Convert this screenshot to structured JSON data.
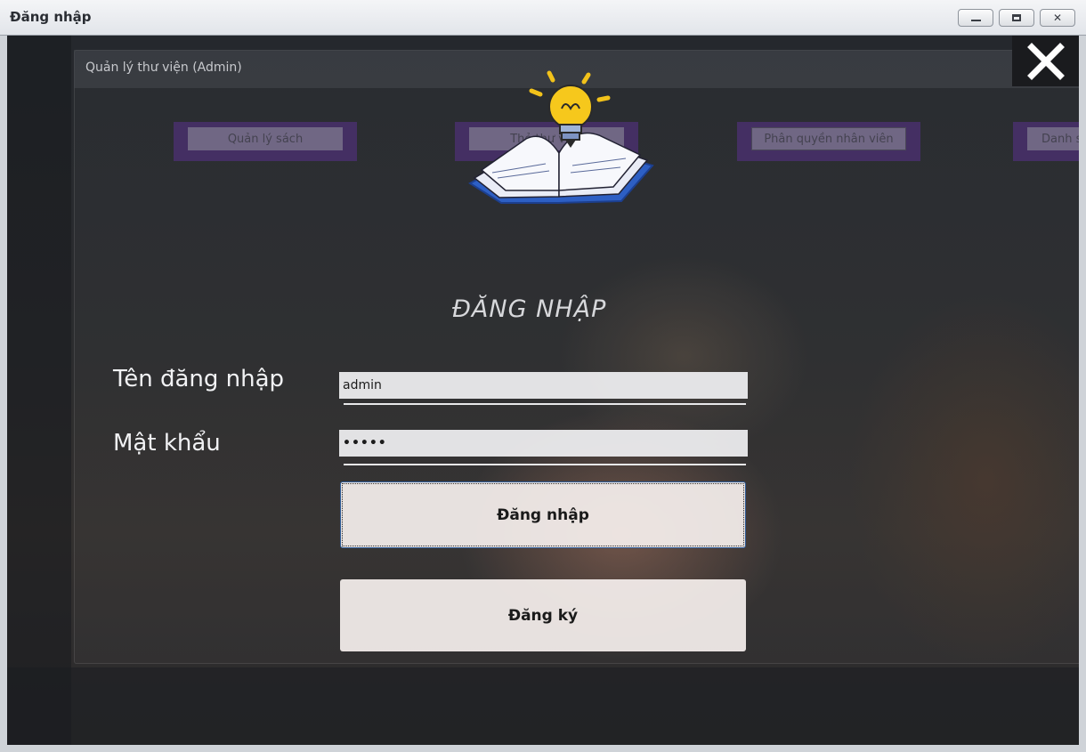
{
  "window": {
    "title": "Đăng nhập"
  },
  "background_app": {
    "title": "Quản lý thư viện (Admin)",
    "menu": [
      "Quản lý sách",
      "Thẻ thư viện",
      "Phân quyền nhân viên",
      "Danh s"
    ]
  },
  "login": {
    "heading": "ĐĂNG NHẬP",
    "username_label": "Tên đăng nhập",
    "username_value": "admin",
    "password_label": "Mật khẩu",
    "password_value": "•••••",
    "login_button": "Đăng nhập",
    "register_button": "Đăng ký"
  },
  "icons": {
    "close": "close-icon",
    "logo": "book-lightbulb-logo"
  },
  "colors": {
    "menu_border": "#5a328c",
    "focus_border": "#2f5d9a"
  }
}
